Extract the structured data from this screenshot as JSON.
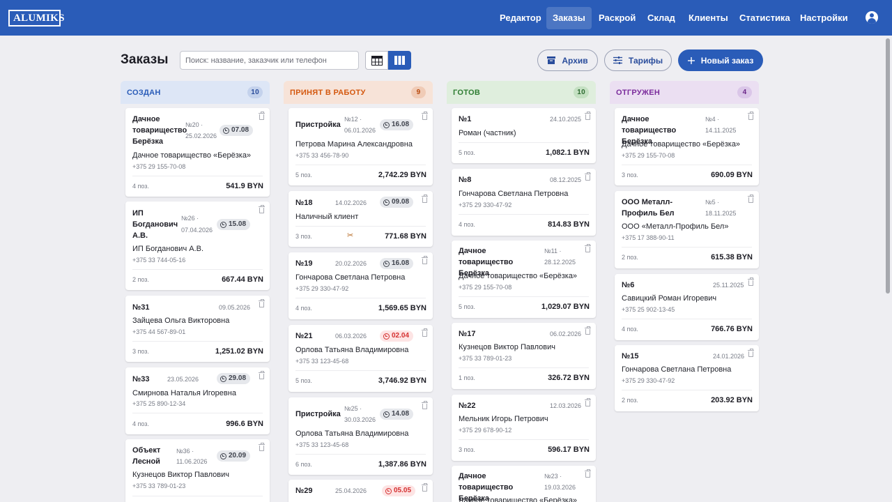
{
  "logo": "ALUMIKS",
  "nav": [
    "Редактор",
    "Заказы",
    "Раскрой",
    "Склад",
    "Клиенты",
    "Статистика",
    "Настройки"
  ],
  "nav_active": "Заказы",
  "page": {
    "title": "Заказы",
    "search_placeholder": "Поиск: название, заказчик или телефон",
    "view_mode": "kanban"
  },
  "actions": {
    "archive": "Архив",
    "tariffs": "Тарифы",
    "new_order": "Новый заказ"
  },
  "colors": {
    "brand": "#2a5cb8",
    "created": "#2a5cb8",
    "in_work": "#d4580f",
    "ready": "#2e7d32",
    "shipped": "#7b2c9c",
    "overdue": "#d53030"
  },
  "columns": [
    {
      "title": "СОЗДАН",
      "count": "10",
      "cards": [
        {
          "title": "Дачное товарищество Берёзка",
          "number": "№20 ·",
          "date": "25.02.2026",
          "deadline": "07.08",
          "customer": "Дачное товарищество «Берёзка»",
          "phone": "+375 29 155-70-08",
          "positions": "4 поз.",
          "total": "541.9 BYN"
        },
        {
          "title": "ИП Богданович А.В.",
          "number": "№26 ·",
          "date": "07.04.2026",
          "deadline": "15.08",
          "customer": "ИП Богданович А.В.",
          "phone": "+375 33 744-05-16",
          "positions": "2 поз.",
          "total": "667.44 BYN"
        },
        {
          "title": "№31",
          "date": "09.05.2026",
          "customer": "Зайцева Ольга Викторовна",
          "phone": "+375 44 567-89-01",
          "positions": "3 поз.",
          "total": "1,251.02 BYN"
        },
        {
          "title": "№33",
          "date": "23.05.2026",
          "deadline": "29.08",
          "customer": "Смирнова Наталья Игоревна",
          "phone": "+375 25 890-12-34",
          "positions": "4 поз.",
          "total": "996.6 BYN"
        },
        {
          "title": "Объект Лесной",
          "number": "№36 ·",
          "date": "11.06.2026",
          "deadline": "20.09",
          "customer": "Кузнецов Виктор Павлович",
          "phone": "+375 33 789-01-23"
        }
      ]
    },
    {
      "title": "ПРИНЯТ В РАБОТУ",
      "count": "9",
      "cards": [
        {
          "title": "Пристройка",
          "number": "№12 ·",
          "date": "06.01.2026",
          "deadline": "16.08",
          "customer": "Петрова Марина Александровна",
          "phone": "+375 33 456-78-90",
          "positions": "5 поз.",
          "total": "2,742.29 BYN"
        },
        {
          "title": "№18",
          "date": "14.02.2026",
          "deadline": "09.08",
          "customer": "Наличный клиент",
          "positions": "3 поз.",
          "total": "771.68 BYN",
          "cut_icon": "scissors-icon"
        },
        {
          "title": "№19",
          "date": "20.02.2026",
          "deadline": "16.08",
          "customer": "Гончарова Светлана Петровна",
          "phone": "+375 29 330-47-92",
          "positions": "4 поз.",
          "total": "1,569.65 BYN"
        },
        {
          "title": "№21",
          "date": "06.03.2026",
          "deadline": "02.04",
          "overdue": true,
          "customer": "Орлова Татьяна Владимировна",
          "phone": "+375 33 123-45-68",
          "positions": "5 поз.",
          "total": "3,746.92 BYN"
        },
        {
          "title": "Пристройка",
          "number": "№25 ·",
          "date": "30.03.2026",
          "deadline": "14.08",
          "customer": "Орлова Татьяна Владимировна",
          "phone": "+375 33 123-45-68",
          "positions": "6 поз.",
          "total": "1,387.86 BYN"
        },
        {
          "title": "№29",
          "date": "25.04.2026",
          "deadline": "05.05",
          "overdue": true
        }
      ]
    },
    {
      "title": "ГОТОВ",
      "count": "10",
      "cards": [
        {
          "title": "№1",
          "date": "24.10.2025",
          "customer": "Роман (частник)",
          "positions": "5 поз.",
          "total": "1,082.1 BYN"
        },
        {
          "title": "№8",
          "date": "08.12.2025",
          "customer": "Гончарова Светлана Петровна",
          "phone": "+375 29 330-47-92",
          "positions": "4 поз.",
          "total": "814.83 BYN"
        },
        {
          "title": "Дачное товарищество Берёзка",
          "number": "№11 ·",
          "date": "28.12.2025",
          "customer": "Дачное товарищество «Берёзка»",
          "phone": "+375 29 155-70-08",
          "positions": "5 поз.",
          "total": "1,029.07 BYN"
        },
        {
          "title": "№17",
          "date": "06.02.2026",
          "customer": "Кузнецов Виктор Павлович",
          "phone": "+375 33 789-01-23",
          "positions": "1 поз.",
          "total": "326.72 BYN"
        },
        {
          "title": "№22",
          "date": "12.03.2026",
          "customer": "Мельник Игорь Петрович",
          "phone": "+375 29 678-90-12",
          "positions": "3 поз.",
          "total": "596.17 BYN"
        },
        {
          "title": "Дачное товарищество Берёзка",
          "number": "№23 ·",
          "date": "19.03.2026",
          "customer": "Дачное товарищество «Берёзка»"
        }
      ]
    },
    {
      "title": "ОТГРУЖЕН",
      "count": "4",
      "cards": [
        {
          "title": "Дачное товарищество Берёзка",
          "number": "№4 ·",
          "date": "14.11.2025",
          "customer": "Дачное товарищество «Берёзка»",
          "phone": "+375 29 155-70-08",
          "positions": "3 поз.",
          "total": "690.09 BYN"
        },
        {
          "title": "ООО Металл-Профиль Бел",
          "number": "№5 ·",
          "date": "18.11.2025",
          "customer": "ООО «Металл-Профиль Бел»",
          "phone": "+375 17 388-90-11",
          "positions": "2 поз.",
          "total": "615.38 BYN"
        },
        {
          "title": "№6",
          "date": "25.11.2025",
          "customer": "Савицкий Роман Игоревич",
          "phone": "+375 25 902-13-45",
          "positions": "4 поз.",
          "total": "766.76 BYN"
        },
        {
          "title": "№15",
          "date": "24.01.2026",
          "customer": "Гончарова Светлана Петровна",
          "phone": "+375 29 330-47-92",
          "positions": "2 поз.",
          "total": "203.92 BYN"
        }
      ]
    }
  ]
}
